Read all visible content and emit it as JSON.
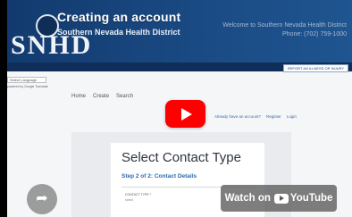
{
  "video": {
    "title": "Creating an account",
    "channel": "Southern Nevada Health District",
    "watch_on_label": "Watch on",
    "youtube_label": "YouTube"
  },
  "site": {
    "logo_text": "SNHD",
    "welcome": "Welcome to Southern Nevada Health District",
    "phone": "Phone: (702) 759-1000",
    "header_link": "REPORT AN ILLNESS OR INJURY",
    "language_select": "Select Language",
    "powered_by": "powered by Google Translate"
  },
  "nav": {
    "items": [
      "Home",
      "Create",
      "Search"
    ]
  },
  "account_links": [
    "Already have an account?",
    "Register",
    "Login"
  ],
  "card": {
    "title": "Select Contact Type",
    "subtitle": "Step 2 of 2: Contact Details",
    "field_label": "CONTACT TYPE *",
    "field_value": "select"
  },
  "colors": {
    "header": "#1a4a83",
    "youtube_red": "#ff0000",
    "link": "#2a6ab0"
  },
  "icons": {
    "play": "play-icon",
    "share": "share-icon",
    "youtube": "youtube-icon"
  }
}
